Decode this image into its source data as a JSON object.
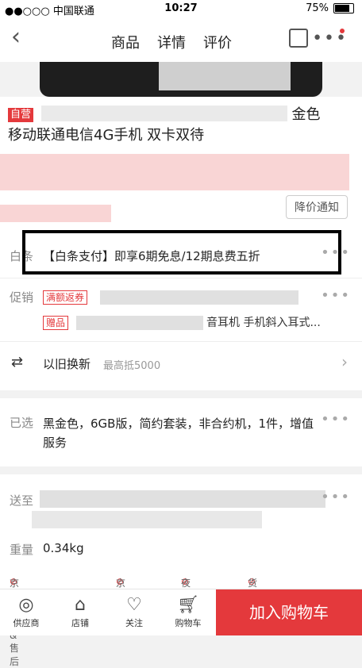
{
  "status": {
    "carrier": "●●○○○ 中国联通",
    "time": "10:27",
    "battery": "75%",
    "battery_level": 0.75
  },
  "nav": {
    "back": "‹",
    "tabs": [
      "商品",
      "详情",
      "评价"
    ],
    "more": "•••"
  },
  "product": {
    "tag": "自营",
    "title_visible": "金色",
    "title_line2": "移动联通电信4G手机 双卡双待",
    "price_alert": "降价通知"
  },
  "baitiao": {
    "label": "白条",
    "text": "【白条支付】即享6期免息/12期息费五折"
  },
  "promo": {
    "label": "促销",
    "tag1": "满额返券",
    "tag2": "赠品",
    "gift_text": "音耳机 手机斜入耳式..."
  },
  "tradein": {
    "label": "以旧换新",
    "sub": "最高抵5000"
  },
  "selected": {
    "label": "已选",
    "value": "黑金色，6GB版，简约套装，非合约机，1件，增值服务"
  },
  "delivery": {
    "label": "送至"
  },
  "weight": {
    "label": "重量",
    "value": "0.34kg"
  },
  "guarantees": [
    "京东发货&售后",
    "京准达",
    "夜间配",
    "货到付款"
  ],
  "bottom": {
    "supplier": "供应商",
    "store": "店铺",
    "follow": "关注",
    "cart": "购物车",
    "add_to_cart": "加入购物车"
  }
}
